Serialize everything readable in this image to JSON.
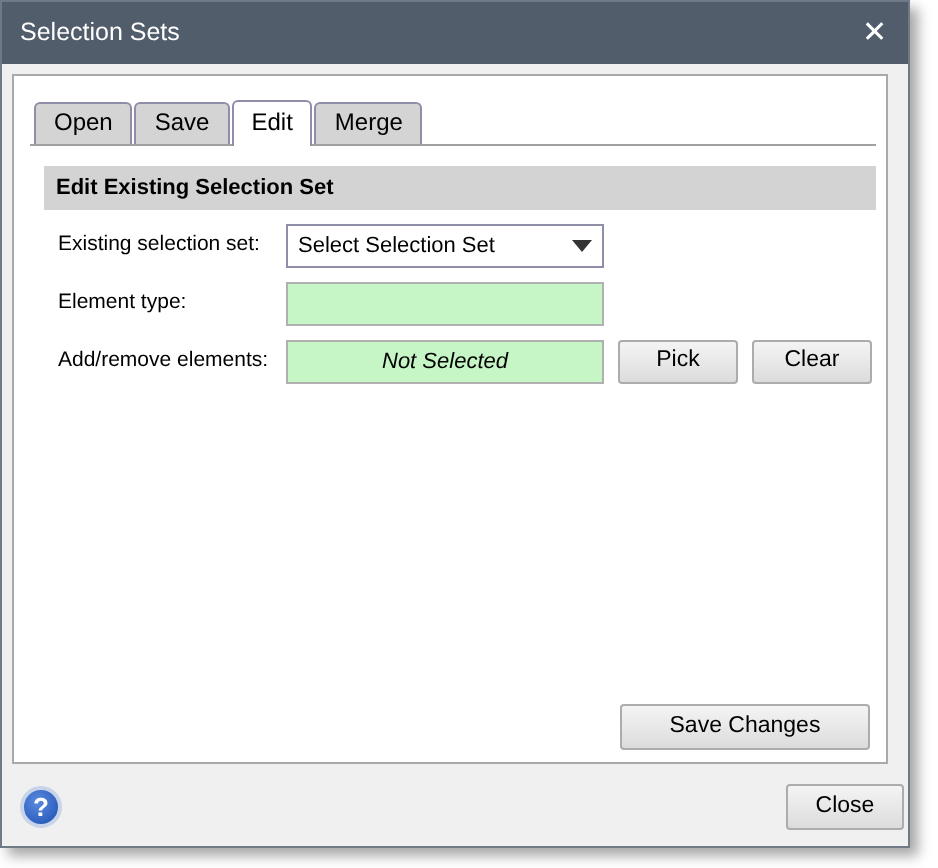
{
  "window": {
    "title": "Selection Sets",
    "close_glyph": "✕"
  },
  "tabs": [
    {
      "label": "Open",
      "selected": false
    },
    {
      "label": "Save",
      "selected": false
    },
    {
      "label": "Edit",
      "selected": true
    },
    {
      "label": "Merge",
      "selected": false
    }
  ],
  "section": {
    "title": "Edit Existing Selection Set"
  },
  "rows": [
    {
      "kind": "dropdown",
      "label": "Existing selection set:",
      "value": "Select Selection Set"
    },
    {
      "kind": "field",
      "label": "Element type:"
    },
    {
      "kind": "field",
      "label": "Add/remove elements:",
      "value": "Not Selected",
      "buttons": [
        "Pick",
        "Clear"
      ]
    }
  ],
  "save_button": "Save Changes",
  "footer": {
    "help_glyph": "?",
    "close_button": "Close"
  }
}
